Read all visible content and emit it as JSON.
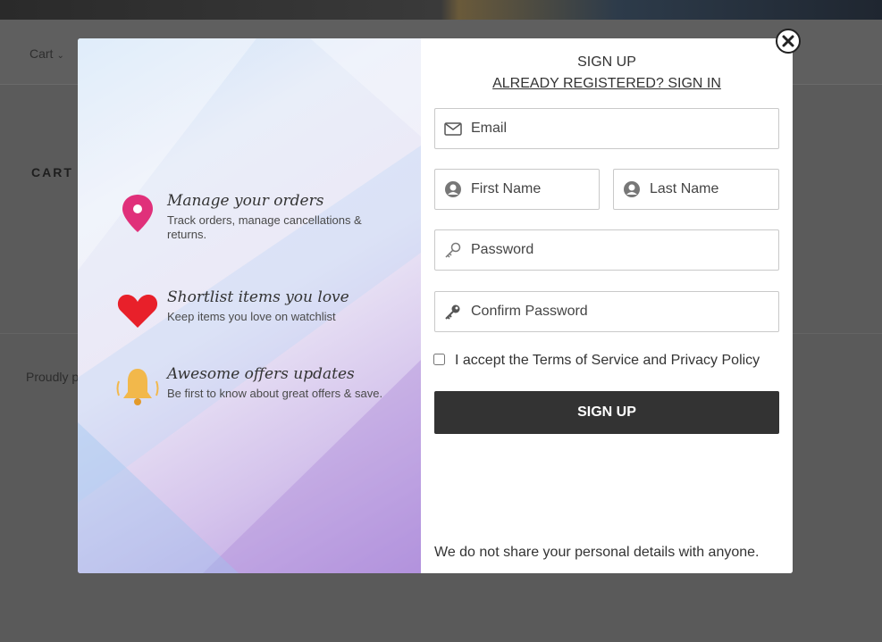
{
  "background": {
    "nav_cart": "Cart",
    "page_heading": "CART",
    "footer_text": "Proudly p"
  },
  "promo": {
    "items": [
      {
        "title": "Manage your orders",
        "desc": "Track orders, manage cancellations & returns.",
        "icon": "location-pin-icon"
      },
      {
        "title": "Shortlist items you love",
        "desc": "Keep items you love on watchlist",
        "icon": "heart-icon"
      },
      {
        "title": "Awesome offers updates",
        "desc": "Be first to know about great offers & save.",
        "icon": "bell-icon"
      }
    ]
  },
  "form": {
    "title": "SIGN UP",
    "signin_link": "ALREADY REGISTERED? SIGN IN",
    "email_placeholder": "Email",
    "first_name_placeholder": "First Name",
    "last_name_placeholder": "Last Name",
    "password_placeholder": "Password",
    "confirm_password_placeholder": "Confirm Password",
    "terms_label": "I accept the Terms of Service and Privacy Policy",
    "submit_label": "SIGN UP",
    "privacy_note": "We do not share your personal details with anyone."
  },
  "colors": {
    "button_bg": "#333333",
    "pin": "#e0307a",
    "heart": "#e8202a",
    "bell": "#f2b84b"
  }
}
